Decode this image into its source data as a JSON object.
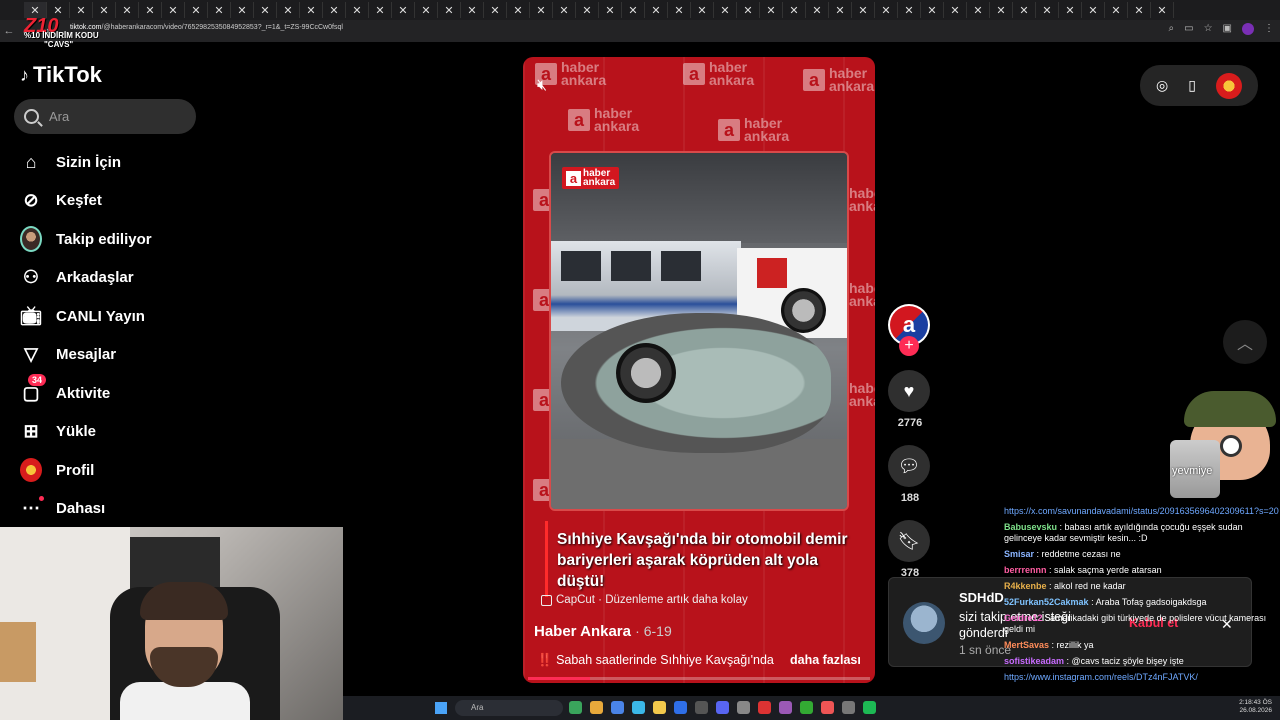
{
  "browser": {
    "tab_count": 50,
    "url_host": "tiktok.com",
    "url_path": "/@haberankaracom/video/7652982535084952853?_r=1&_t=ZS-99CcCw0fsql"
  },
  "overlay": {
    "promo_brand": "Z10",
    "promo_line1": "%10 İNDİRİM KODU",
    "promo_line2": "\"CAVS\""
  },
  "sidebar": {
    "logo_text": "TikTok",
    "search_placeholder": "Ara",
    "items": [
      {
        "label": "Sizin İçin",
        "icon": "home-icon"
      },
      {
        "label": "Keşfet",
        "icon": "compass-icon"
      },
      {
        "label": "Takip ediliyor",
        "icon": "avatar"
      },
      {
        "label": "Arkadaşlar",
        "icon": "friends-icon"
      },
      {
        "label": "CANLI Yayın",
        "icon": "live-tv-icon"
      },
      {
        "label": "Mesajlar",
        "icon": "send-icon"
      },
      {
        "label": "Aktivite",
        "icon": "inbox-icon",
        "badge": "34"
      },
      {
        "label": "Yükle",
        "icon": "upload-icon"
      },
      {
        "label": "Profil",
        "icon": "profile-avatar"
      },
      {
        "label": "Dahası",
        "icon": "more-icon"
      }
    ]
  },
  "video": {
    "watermark": "haber ankara",
    "watermark_line1": "haber",
    "watermark_line2": "ankara",
    "headline": "Sıhhiye Kavşağı'nda bir otomobil demir bariyerleri aşarak köprüden alt yola düştü!",
    "capcut_label": "CapCut · Düzenleme artık daha kolay",
    "author": "Haber Ankara",
    "date": "· 6-19",
    "description_prefix": "‼️",
    "description": "Sabah saatlerinde Sıhhiye Kavşağı'nda",
    "more_label": "daha fazlası",
    "progress": 0.18
  },
  "actions": {
    "likes": "2776",
    "comments": "188",
    "saves": "378"
  },
  "mascot": {
    "can_label": "yevmiye"
  },
  "chat": [
    {
      "user": "",
      "text": "https://x.com/savunandavadami/status/2091635696402309611?s=20",
      "link": true
    },
    {
      "user": "Babusevsku",
      "color": "#7ee08a",
      "text": "babası artık ayıldığında çocuğu eşşek sudan gelinceye kadar sevmiştir kesin... :D"
    },
    {
      "user": "Smisar",
      "color": "#8ab4ff",
      "text": "reddetme cezası ne"
    },
    {
      "user": "berrrennn",
      "color": "#ff5da2",
      "text": "salak saçma yerde atarsan"
    },
    {
      "user": "R4kkenbe",
      "color": "#e8b04a",
      "text": "alkol red ne kadar"
    },
    {
      "user": "52Furkan52Cakmak",
      "color": "#7fc3ff",
      "text": "Araba Tofaş gadsoigakdsga"
    },
    {
      "user": "Geidre12",
      "color": "#ff6fd1",
      "text": "amerikadaki gibi türkiyede de polislere vücut kamerası geldi mi"
    },
    {
      "user": "MertSavas",
      "color": "#ff8c5a",
      "text": "rezillik ya"
    },
    {
      "user": "sofistikeadam",
      "color": "#c86bff",
      "text": "@cavs taciz şöyle bişey işte"
    },
    {
      "user": "",
      "text": "https://www.instagram.com/reels/DTz4nFJATVK/",
      "link": true
    }
  ],
  "notification": {
    "name": "SDHdD",
    "message": "sizi takip etme isteği gönderdi",
    "time": "1 sn önce",
    "accept_label": "Kabul et"
  },
  "taskbar": {
    "search_placeholder": "Ara",
    "time": "2:18:43 ÖS",
    "date": "26.08.2026"
  }
}
